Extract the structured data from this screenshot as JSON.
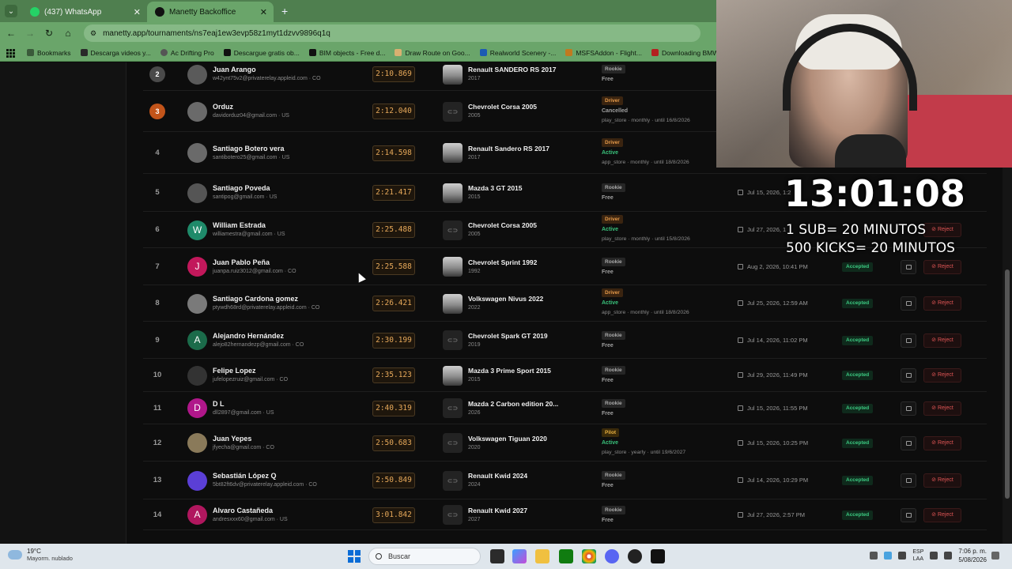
{
  "tabs": [
    {
      "title": "(437) WhatsApp",
      "active": false
    },
    {
      "title": "Manetty Backoffice",
      "active": true
    }
  ],
  "new_tab": "+",
  "url": "manetty.app/tournaments/ns7eaj1ew3evp58z1myt1dzvv9896q1q",
  "bookmarks": [
    {
      "label": "Bookmarks",
      "color": "#3a5a3a"
    },
    {
      "label": "Descarga videos y...",
      "color": "#2a2a2a"
    },
    {
      "label": "Ac Drifting Pro",
      "color": "#555555"
    },
    {
      "label": "Descargue gratis ob...",
      "color": "#111111"
    },
    {
      "label": "BIM objects - Free d...",
      "color": "#111111"
    },
    {
      "label": "Draw Route on Goo...",
      "color": "#d9b071"
    },
    {
      "label": "Realworld Scenery -...",
      "color": "#1c5bb3"
    },
    {
      "label": "MSFSAddon - Flight...",
      "color": "#c07a20"
    },
    {
      "label": "Downloading BMW...",
      "color": "#b42020"
    }
  ],
  "rows": [
    {
      "rank": "2",
      "badge_color": "#4a4a4a",
      "avatar": "",
      "avatar_color": "#5a5a5a",
      "name": "Juan Arango",
      "email": "w42ynt75v2@privaterelay.appleid.com · CO",
      "time": "2:10.869",
      "car": "Renault SANDERO RS 2017",
      "car_year": "2017",
      "car_photo": true,
      "tier": "Rookie",
      "tier_class": "rookie",
      "sub": "Free",
      "sub_class": "free",
      "sub_info": "",
      "date": "",
      "status": "",
      "reject": ""
    },
    {
      "rank": "3",
      "badge_color": "#c2541a",
      "avatar": "",
      "avatar_color": "#6a6a6a",
      "name": "Orduz",
      "email": "davidorduz04@gmail.com · US",
      "time": "2:12.040",
      "car": "Chevrolet Corsa 2005",
      "car_year": "2005",
      "car_photo": false,
      "tier": "Driver",
      "tier_class": "driver",
      "sub": "Cancelled",
      "sub_class": "cancelled",
      "sub_info": "play_store · monthly · until 16/8/2026",
      "date": "",
      "status": "",
      "reject": ""
    },
    {
      "rank": "4",
      "badge_color": "",
      "avatar": "",
      "avatar_color": "#6a6a6a",
      "name": "Santiago Botero vera",
      "email": "santibotero25@gmail.com · US",
      "time": "2:14.598",
      "car": "Renault Sandero RS 2017",
      "car_year": "2017",
      "car_photo": true,
      "tier": "Driver",
      "tier_class": "driver",
      "sub": "Active",
      "sub_class": "active",
      "sub_info": "app_store · monthly · until 18/8/2026",
      "date": "",
      "status": "",
      "reject": ""
    },
    {
      "rank": "5",
      "badge_color": "",
      "avatar": "",
      "avatar_color": "#555555",
      "name": "Santiago Poveda",
      "email": "santipog@gmail.com · US",
      "time": "2:21.417",
      "car": "Mazda 3 GT 2015",
      "car_year": "2015",
      "car_photo": true,
      "tier": "Rookie",
      "tier_class": "rookie",
      "sub": "Free",
      "sub_class": "free",
      "sub_info": "",
      "date": "Jul 15, 2026, 1:2",
      "status": "",
      "reject": ""
    },
    {
      "rank": "6",
      "badge_color": "",
      "avatar": "W",
      "avatar_color": "#1f8a6a",
      "name": "William Estrada",
      "email": "williamestra@gmail.com · US",
      "time": "2:25.488",
      "car": "Chevrolet Corsa 2005",
      "car_year": "2005",
      "car_photo": false,
      "tier": "Driver",
      "tier_class": "driver",
      "sub": "Active",
      "sub_class": "active",
      "sub_info": "play_store · monthly · until 15/8/2026",
      "date": "Jul 27, 2026, 1",
      "status": "",
      "reject": "Reject"
    },
    {
      "rank": "7",
      "badge_color": "",
      "avatar": "J",
      "avatar_color": "#c2185b",
      "name": "Juan Pablo Peña",
      "email": "juanpa.ruiz3012@gmail.com · CO",
      "time": "2:25.588",
      "car": "Chevrolet Sprint 1992",
      "car_year": "1992",
      "car_photo": true,
      "tier": "Rookie",
      "tier_class": "rookie",
      "sub": "Free",
      "sub_class": "free",
      "sub_info": "",
      "date": "Aug 2, 2026, 10:41 PM",
      "status": "Accepted",
      "reject": "Reject"
    },
    {
      "rank": "8",
      "badge_color": "",
      "avatar": "",
      "avatar_color": "#7a7a7a",
      "name": "Santiago Cardona gomez",
      "email": "ptywdh68rd@privaterelay.appleid.com · CO",
      "time": "2:26.421",
      "car": "Volkswagen Nivus 2022",
      "car_year": "2022",
      "car_photo": true,
      "tier": "Driver",
      "tier_class": "driver",
      "sub": "Active",
      "sub_class": "active",
      "sub_info": "app_store · monthly · until 18/8/2026",
      "date": "Jul 25, 2026, 12:59 AM",
      "status": "Accepted",
      "reject": "Reject"
    },
    {
      "rank": "9",
      "badge_color": "",
      "avatar": "A",
      "avatar_color": "#1b6b4a",
      "name": "Alejandro Hernández",
      "email": "alejo82hernandezp@gmail.com · CO",
      "time": "2:30.199",
      "car": "Chevrolet Spark GT 2019",
      "car_year": "2019",
      "car_photo": false,
      "tier": "Rookie",
      "tier_class": "rookie",
      "sub": "Free",
      "sub_class": "free",
      "sub_info": "",
      "date": "Jul 14, 2026, 11:02 PM",
      "status": "Accepted",
      "reject": "Reject"
    },
    {
      "rank": "10",
      "badge_color": "",
      "avatar": "",
      "avatar_color": "#333333",
      "name": "Felipe Lopez",
      "email": "jufelopezruiz@gmail.com · CO",
      "time": "2:35.123",
      "car": "Mazda 3 Prime Sport 2015",
      "car_year": "2015",
      "car_photo": true,
      "tier": "Rookie",
      "tier_class": "rookie",
      "sub": "Free",
      "sub_class": "free",
      "sub_info": "",
      "date": "Jul 29, 2026, 11:49 PM",
      "status": "Accepted",
      "reject": "Reject"
    },
    {
      "rank": "11",
      "badge_color": "",
      "avatar": "D",
      "avatar_color": "#b0178a",
      "name": "D L",
      "email": "dll2897@gmail.com · US",
      "time": "2:40.319",
      "car": "Mazda 2 Carbon edition 20...",
      "car_year": "2026",
      "car_photo": false,
      "tier": "Rookie",
      "tier_class": "rookie",
      "sub": "Free",
      "sub_class": "free",
      "sub_info": "",
      "date": "Jul 15, 2026, 11:55 PM",
      "status": "Accepted",
      "reject": "Reject"
    },
    {
      "rank": "12",
      "badge_color": "",
      "avatar": "",
      "avatar_color": "#8a7a5a",
      "name": "Juan Yepes",
      "email": "jfyecha@gmail.com · CO",
      "time": "2:50.683",
      "car": "Volkswagen Tiguan 2020",
      "car_year": "2020",
      "car_photo": false,
      "tier": "Pilot",
      "tier_class": "pilot",
      "sub": "Active",
      "sub_class": "active",
      "sub_info": "play_store · yearly · until 19/6/2027",
      "date": "Jul 15, 2026, 10:25 PM",
      "status": "Accepted",
      "reject": "Reject"
    },
    {
      "rank": "13",
      "badge_color": "",
      "avatar": "",
      "avatar_color": "#5b3fd6",
      "name": "Sebastián López Q",
      "email": "5bt82ft6dv@privaterelay.appleid.com · CO",
      "time": "2:50.849",
      "car": "Renault Kwid 2024",
      "car_year": "2024",
      "car_photo": false,
      "tier": "Rookie",
      "tier_class": "rookie",
      "sub": "Free",
      "sub_class": "free",
      "sub_info": "",
      "date": "Jul 14, 2026, 10:29 PM",
      "status": "Accepted",
      "reject": "Reject"
    },
    {
      "rank": "14",
      "badge_color": "",
      "avatar": "A",
      "avatar_color": "#b0175e",
      "name": "Alvaro Castañeda",
      "email": "andresxxx60@gmail.com · US",
      "time": "3:01.842",
      "car": "Renault Kwid 2027",
      "car_year": "2027",
      "car_photo": false,
      "tier": "Rookie",
      "tier_class": "rookie",
      "sub": "Free",
      "sub_class": "free",
      "sub_info": "",
      "date": "Jul 27, 2026, 2:57 PM",
      "status": "Accepted",
      "reject": "Reject"
    }
  ],
  "overlay": {
    "timer": "13:01:08",
    "line1": "1 SUB= 20 MINUTOS",
    "line2": "500 KICKS= 20 MINUTOS"
  },
  "taskbar": {
    "temp": "19°C",
    "weather": "Mayorm. nublado",
    "search": "Buscar",
    "lang_top": "ESP",
    "lang_bottom": "LAA",
    "time": "7:06 p. m.",
    "date": "5/08/2026"
  }
}
